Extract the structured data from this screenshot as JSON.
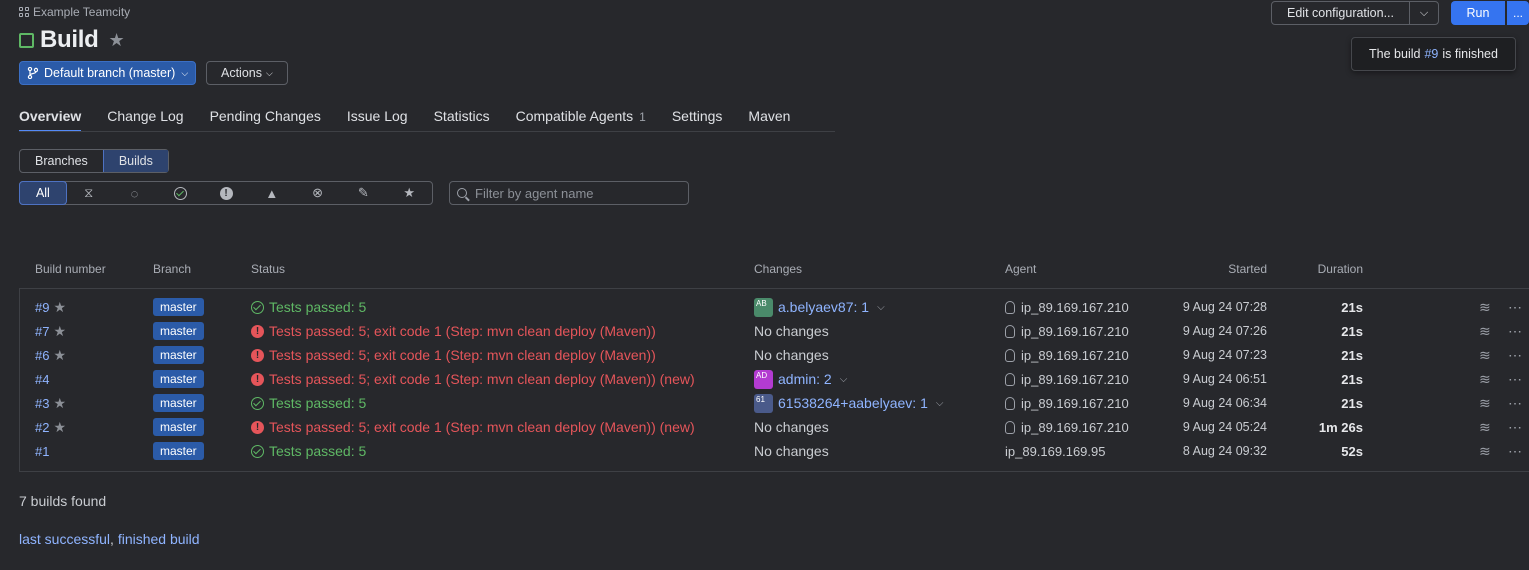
{
  "header": {
    "project": "Example Teamcity",
    "title": "Build",
    "branch_button": "Default branch (master)",
    "actions_button": "Actions"
  },
  "toolbar": {
    "edit_configuration": "Edit configuration...",
    "run": "Run",
    "more": "..."
  },
  "tooltip": {
    "prefix": "The build",
    "link": "#9",
    "suffix": "is finished"
  },
  "tabs": [
    {
      "label": "Overview",
      "active": true
    },
    {
      "label": "Change Log"
    },
    {
      "label": "Pending Changes"
    },
    {
      "label": "Issue Log"
    },
    {
      "label": "Statistics"
    },
    {
      "label": "Compatible Agents",
      "badge": "1"
    },
    {
      "label": "Settings"
    },
    {
      "label": "Maven"
    }
  ],
  "view_toggle": {
    "branches": "Branches",
    "builds": "Builds"
  },
  "filter": {
    "all": "All",
    "icons": [
      "hourglass-icon",
      "running-icon",
      "success-icon",
      "error-icon",
      "warning-icon",
      "cancelled-icon",
      "pin-icon",
      "star-icon"
    ],
    "search_placeholder": "Filter by agent name"
  },
  "table": {
    "headers": {
      "build_number": "Build number",
      "branch": "Branch",
      "status": "Status",
      "changes": "Changes",
      "agent": "Agent",
      "started": "Started",
      "duration": "Duration"
    },
    "rows": [
      {
        "number": "#9",
        "star": true,
        "branch": "master",
        "status_type": "ok",
        "status": "Tests passed: 5",
        "changes": "a.belyaev87: 1",
        "avatar": "AB",
        "avatar_color": "#4a8a6a",
        "agent": "ip_89.169.167.210",
        "linux": true,
        "started": "9 Aug 24 07:28",
        "duration": "21s"
      },
      {
        "number": "#7",
        "star": true,
        "branch": "master",
        "status_type": "err",
        "status": "Tests passed: 5; exit code 1 (Step: mvn clean deploy (Maven))",
        "changes": "No changes",
        "agent": "ip_89.169.167.210",
        "linux": true,
        "started": "9 Aug 24 07:26",
        "duration": "21s"
      },
      {
        "number": "#6",
        "star": true,
        "branch": "master",
        "status_type": "err",
        "status": "Tests passed: 5; exit code 1 (Step: mvn clean deploy (Maven))",
        "changes": "No changes",
        "agent": "ip_89.169.167.210",
        "linux": true,
        "started": "9 Aug 24 07:23",
        "duration": "21s"
      },
      {
        "number": "#4",
        "star": false,
        "branch": "master",
        "status_type": "err",
        "status": "Tests passed: 5; exit code 1 (Step: mvn clean deploy (Maven)) (new)",
        "changes": "admin: 2",
        "avatar": "AD",
        "avatar_color": "#b33bd1",
        "agent": "ip_89.169.167.210",
        "linux": true,
        "started": "9 Aug 24 06:51",
        "duration": "21s"
      },
      {
        "number": "#3",
        "star": true,
        "branch": "master",
        "status_type": "ok",
        "status": "Tests passed: 5",
        "changes": "61538264+aabelyaev: 1",
        "avatar": "61",
        "avatar_color": "#4a5a8a",
        "agent": "ip_89.169.167.210",
        "linux": true,
        "started": "9 Aug 24 06:34",
        "duration": "21s"
      },
      {
        "number": "#2",
        "star": true,
        "branch": "master",
        "status_type": "err",
        "status": "Tests passed: 5; exit code 1 (Step: mvn clean deploy (Maven)) (new)",
        "changes": "No changes",
        "agent": "ip_89.169.167.210",
        "linux": true,
        "started": "9 Aug 24 05:24",
        "duration": "1m 26s"
      },
      {
        "number": "#1",
        "star": false,
        "branch": "master",
        "status_type": "ok",
        "status": "Tests passed: 5",
        "changes": "No changes",
        "agent": "ip_89.169.169.95",
        "linux": false,
        "started": "8 Aug 24 09:32",
        "duration": "52s"
      }
    ]
  },
  "footer": {
    "found": "7 builds found",
    "link1": "last successful",
    "separator": ",",
    "link2": "finished build"
  },
  "colors": {
    "accent": "#3574f0",
    "success": "#5fb865",
    "error": "#e5555a",
    "branch_tag": "#2b5ba8"
  }
}
